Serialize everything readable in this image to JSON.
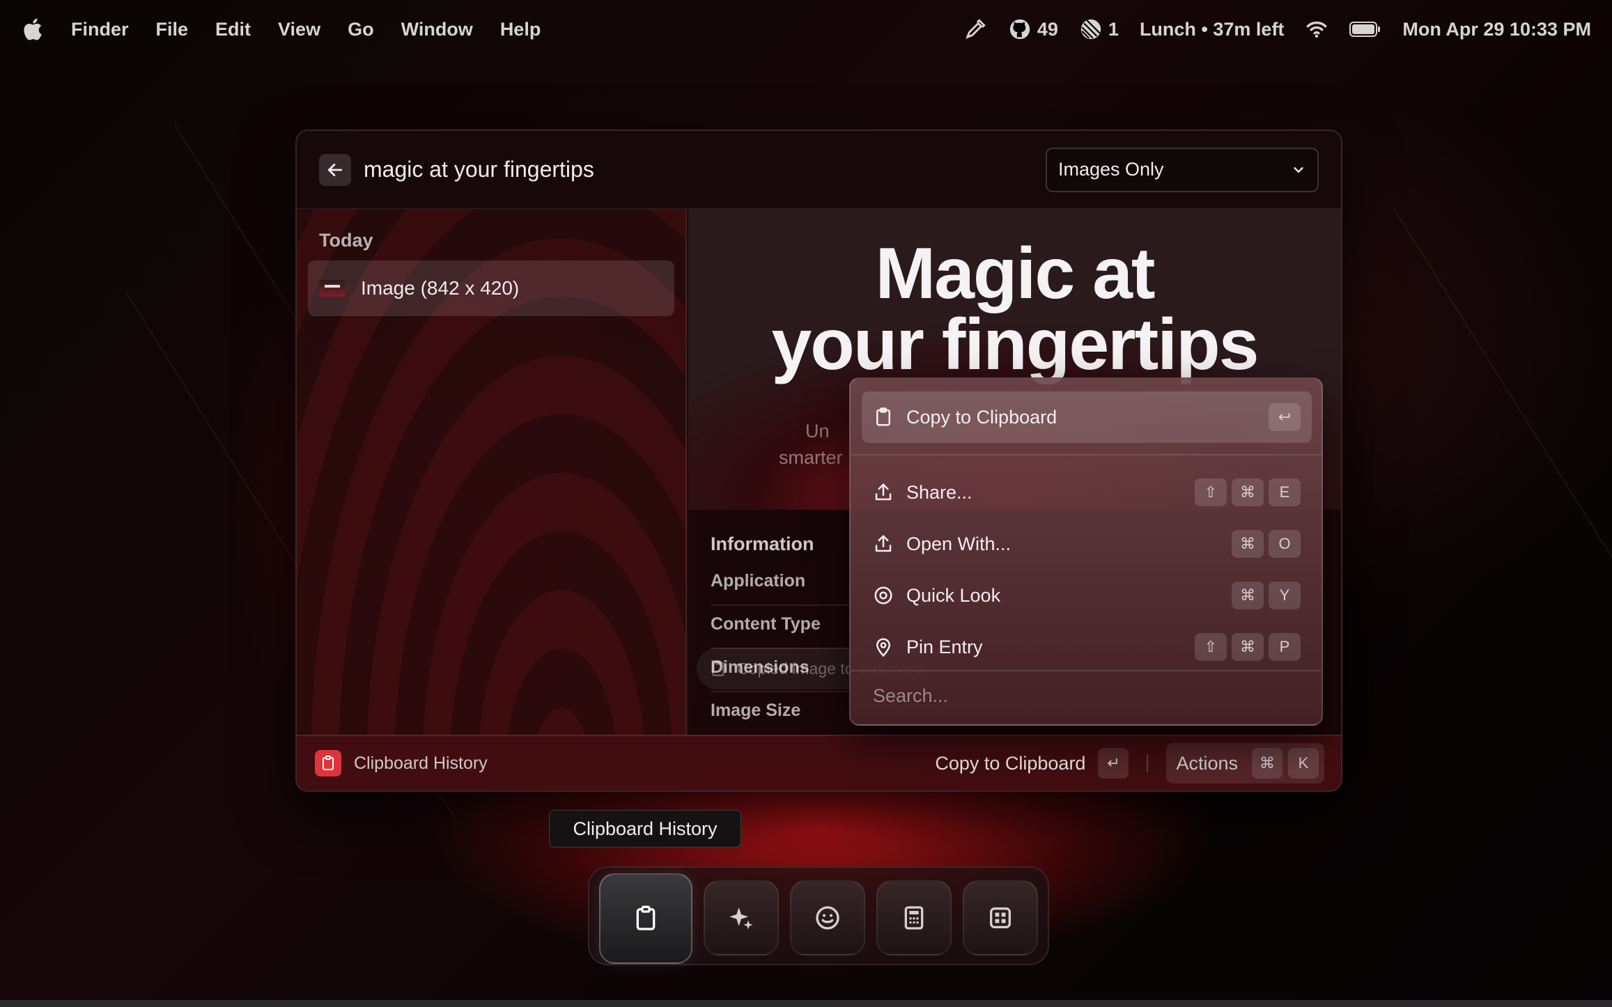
{
  "menubar": {
    "app_name": "Finder",
    "menus": [
      "File",
      "Edit",
      "View",
      "Go",
      "Window",
      "Help"
    ],
    "github_count": "49",
    "notification_count": "1",
    "calendar_status": "Lunch • 37m left",
    "datetime": "Mon Apr 29  10:33 PM"
  },
  "window": {
    "search_query": "magic at your fingertips",
    "filter_selected": "Images Only",
    "list": {
      "section_label": "Today",
      "items": [
        {
          "label": "Image (842 x 420)"
        }
      ]
    },
    "preview": {
      "title_line1": "Magic at",
      "title_line2": "your fingertips",
      "sub_line1": "Un",
      "sub_line2": "smarter"
    },
    "info": {
      "title": "Information",
      "rows": [
        "Application",
        "Content Type",
        "Dimensions",
        "Image Size"
      ]
    },
    "toast": "Copied image to clipboard",
    "footer": {
      "app_label": "Clipboard History",
      "primary_action": "Copy to Clipboard",
      "primary_key": "↵",
      "actions_label": "Actions",
      "actions_keys": [
        "⌘",
        "K"
      ]
    }
  },
  "popover": {
    "items": [
      {
        "label": "Copy to Clipboard",
        "keys": [
          "↩"
        ],
        "icon": "clipboard-icon"
      },
      {
        "label": "Share...",
        "keys": [
          "⇧",
          "⌘",
          "E"
        ],
        "icon": "share-icon"
      },
      {
        "label": "Open With...",
        "keys": [
          "⌘",
          "O"
        ],
        "icon": "open-with-icon"
      },
      {
        "label": "Quick Look",
        "keys": [
          "⌘",
          "Y"
        ],
        "icon": "eye-icon"
      },
      {
        "label": "Pin Entry",
        "keys": [
          "⇧",
          "⌘",
          "P"
        ],
        "icon": "pin-icon"
      }
    ],
    "search_placeholder": "Search..."
  },
  "dock": {
    "tooltip": "Clipboard History",
    "items": [
      "clipboard-icon",
      "sparkles-icon",
      "smiley-icon",
      "calculator-icon",
      "grid-icon"
    ]
  }
}
